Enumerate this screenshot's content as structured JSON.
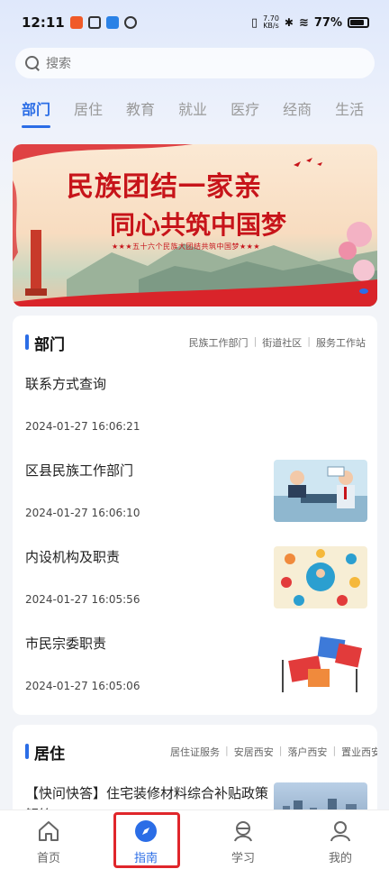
{
  "status": {
    "time": "12:11",
    "net_speed_top": "7.70",
    "net_speed_bottom": "KB/s",
    "battery": "77%"
  },
  "search": {
    "placeholder": "搜索"
  },
  "tabs": [
    {
      "label": "部门"
    },
    {
      "label": "居住"
    },
    {
      "label": "教育"
    },
    {
      "label": "就业"
    },
    {
      "label": "医疗"
    },
    {
      "label": "经商"
    },
    {
      "label": "生活"
    }
  ],
  "banner": {
    "title_line1": "民族团结一家亲",
    "title_line2": "同心共筑中国梦",
    "subtitle": "★★★五十六个民族大团结共筑中国梦★★★"
  },
  "sections": [
    {
      "title": "部门",
      "links": [
        "民族工作部门",
        "街道社区",
        "服务工作站"
      ],
      "items": [
        {
          "title": "联系方式查询",
          "date": "2024-01-27 16:06:21"
        },
        {
          "title": "区县民族工作部门",
          "date": "2024-01-27 16:06:10"
        },
        {
          "title": "内设机构及职责",
          "date": "2024-01-27 16:05:56"
        },
        {
          "title": "市民宗委职责",
          "date": "2024-01-27 16:05:06"
        }
      ]
    },
    {
      "title": "居住",
      "links": [
        "居住证服务",
        "安居西安",
        "落户西安",
        "置业西安"
      ],
      "items": [
        {
          "title": "【快问快答】住宅装修材料综合补贴政策解答"
        }
      ]
    }
  ],
  "tabbar": [
    {
      "label": "首页",
      "icon": "home-icon"
    },
    {
      "label": "指南",
      "icon": "compass-icon"
    },
    {
      "label": "学习",
      "icon": "study-icon"
    },
    {
      "label": "我的",
      "icon": "profile-icon"
    }
  ],
  "colors": {
    "accent": "#2b6de6",
    "highlight": "#e0262b",
    "banner_red": "#c7141a"
  }
}
